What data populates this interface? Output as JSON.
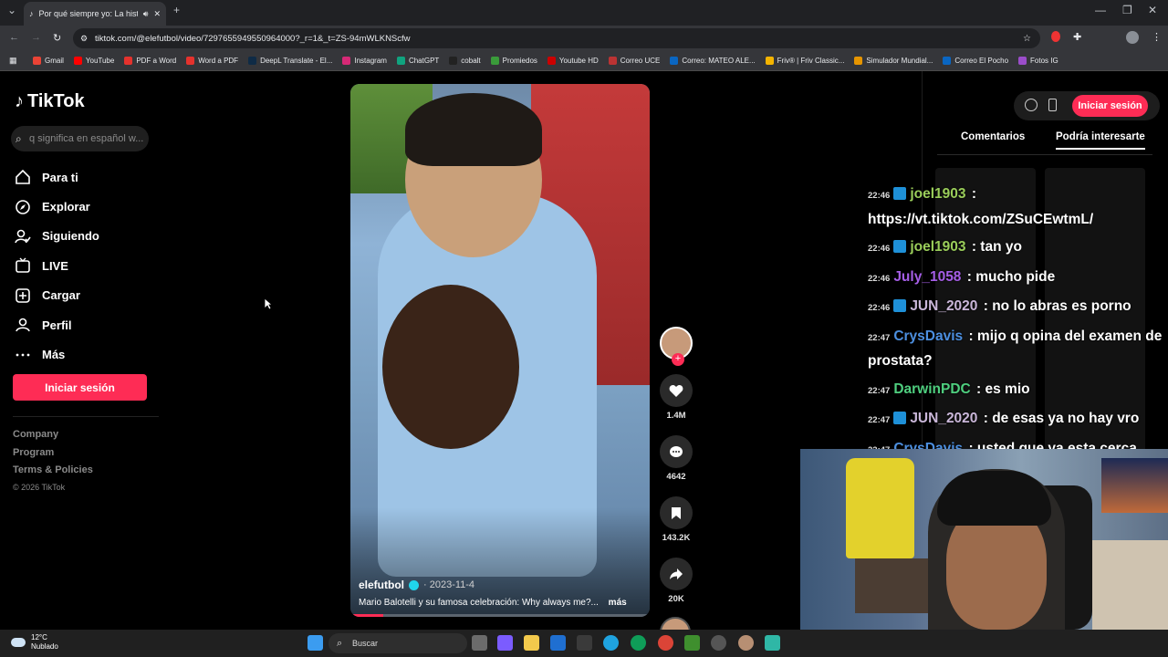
{
  "browser": {
    "tab_title": "Por qué siempre yo: La histo",
    "url": "tiktok.com/@elefutbol/video/7297655949550964000?_r=1&_t=ZS-94mWLKNScfw",
    "bookmarks": [
      "Gmail",
      "YouTube",
      "PDF a Word",
      "Word a PDF",
      "DeepL Translate - El...",
      "Instagram",
      "ChatGPT",
      "cobalt",
      "Promiedos",
      "Youtube HD",
      "Correo UCE",
      "Correo: MATEO ALE...",
      "Friv® | Friv Classic...",
      "Simulador Mundial...",
      "Correo El Pocho",
      "Fotos IG"
    ]
  },
  "sidebar": {
    "logo": "TikTok",
    "search_placeholder": "q significa en español w...",
    "nav": [
      "Para ti",
      "Explorar",
      "Siguiendo",
      "LIVE",
      "Cargar",
      "Perfil",
      "Más"
    ],
    "login": "Iniciar sesión",
    "footer": [
      "Company",
      "Program",
      "Terms & Policies"
    ],
    "copyright": "© 2026 TikTok"
  },
  "video": {
    "author": "elefutbol",
    "date": "· 2023-11-4",
    "description": "Mario Balotelli y su famosa celebración: Why always me?...",
    "more": "más",
    "progress": 0.11
  },
  "actions": {
    "likes": "1.4M",
    "comments": "4642",
    "saves": "143.2K",
    "shares": "20K"
  },
  "right_panel": {
    "login": "Iniciar sesión",
    "tabs": [
      "Comentarios",
      "Podría interesarte"
    ],
    "active_tab": "Podría interesarte"
  },
  "chat": [
    {
      "time": "22:46",
      "badge": true,
      "user": "joel1903",
      "color": "#9acd5a",
      "text": ": https://vt.tiktok.com/ZSuCEwtmL/"
    },
    {
      "time": "22:46",
      "badge": true,
      "user": "joel1903",
      "color": "#9acd5a",
      "text": ": tan yo"
    },
    {
      "time": "22:46",
      "badge": false,
      "user": "July_1058",
      "color": "#a55ee6",
      "text": ": mucho pide"
    },
    {
      "time": "22:46",
      "badge": true,
      "user": "JUN_2020",
      "color": "#c9b6d8",
      "text": ": no lo abras es porno"
    },
    {
      "time": "22:47",
      "badge": false,
      "user": "CrysDavis",
      "color": "#4c8fe0",
      "text": ": mijo q opina del examen de prostata?"
    },
    {
      "time": "22:47",
      "badge": false,
      "user": "DarwinPDC",
      "color": "#4fcf7f",
      "text": ": es mio"
    },
    {
      "time": "22:47",
      "badge": true,
      "user": "JUN_2020",
      "color": "#c9b6d8",
      "text": ": de esas ya no hay vro"
    },
    {
      "time": "22:47",
      "badge": false,
      "user": "CrysDavis",
      "color": "#4c8fe0",
      "text": ": usted que ya esta cerca"
    }
  ],
  "taskbar": {
    "temp": "12°C",
    "weather": "Nublado",
    "search": "Buscar"
  },
  "colors": {
    "accent": "#fe2c55",
    "verified": "#20d5ec"
  }
}
